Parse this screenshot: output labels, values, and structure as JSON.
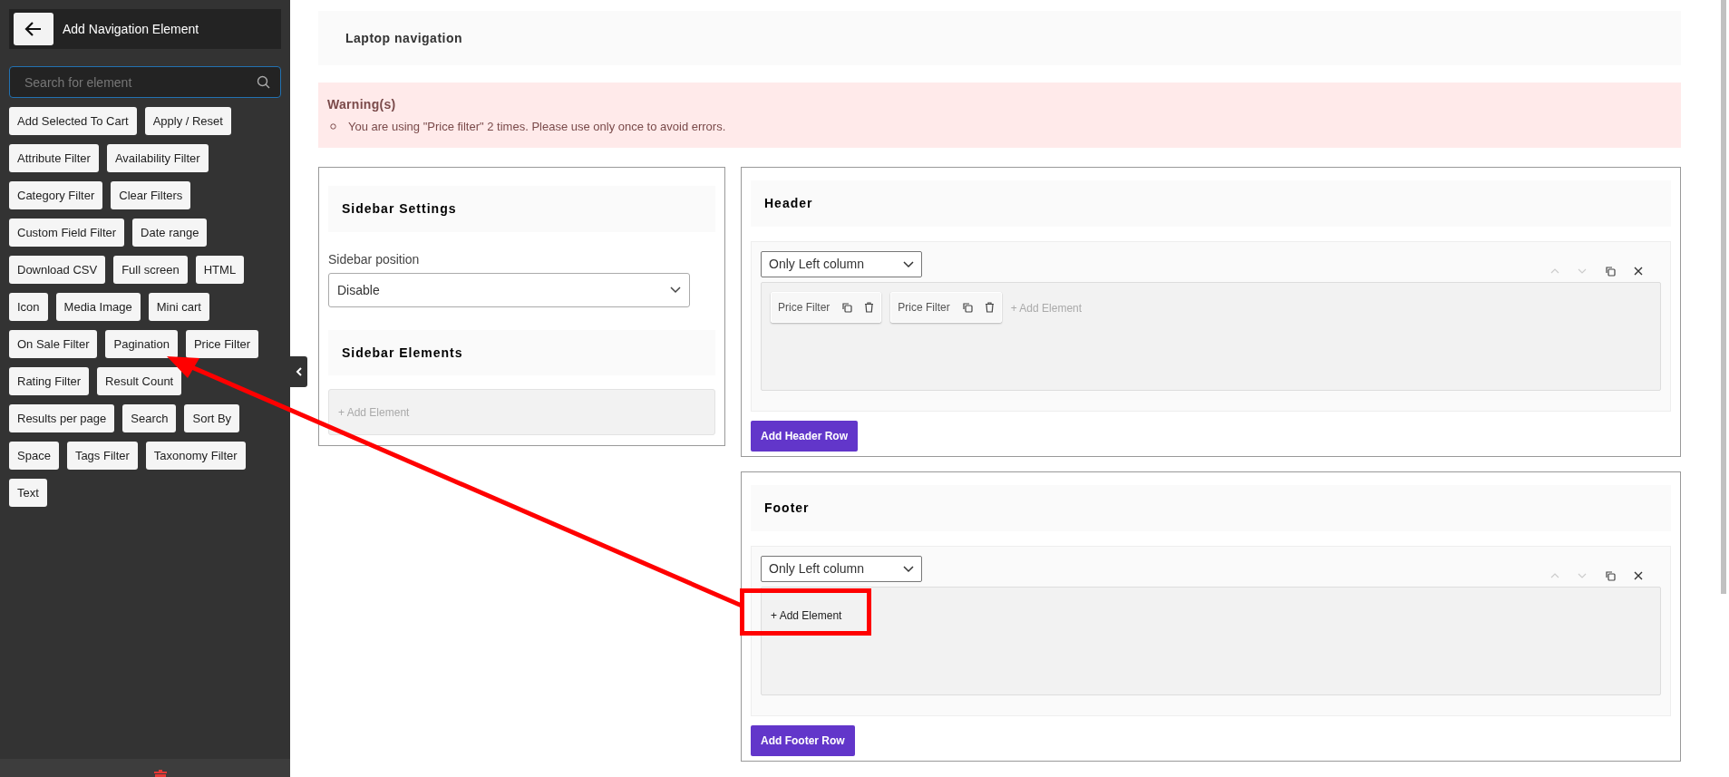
{
  "panel": {
    "title": "Add Navigation Element",
    "search": {
      "placeholder": "Search for element"
    },
    "elements": [
      "Add Selected To Cart",
      "Apply / Reset",
      "Attribute Filter",
      "Availability Filter",
      "Category Filter",
      "Clear Filters",
      "Custom Field Filter",
      "Date range",
      "Download CSV",
      "Full screen",
      "HTML",
      "Icon",
      "Media Image",
      "Mini cart",
      "On Sale Filter",
      "Pagination",
      "Price Filter",
      "Rating Filter",
      "Result Count",
      "Results per page",
      "Search",
      "Sort By",
      "Space",
      "Tags Filter",
      "Taxonomy Filter",
      "Text"
    ]
  },
  "page_title": "Laptop navigation",
  "warning": {
    "title": "Warning(s)",
    "messages": [
      "You are using \"Price filter\" 2 times. Please use only once to avoid errors."
    ]
  },
  "sidebar_settings": {
    "title": "Sidebar Settings",
    "position_label": "Sidebar position",
    "position_value": "Disable",
    "elements_title": "Sidebar Elements",
    "add_element": "+ Add Element"
  },
  "sections": [
    {
      "title": "Header",
      "layout": "Only Left column",
      "elements": [
        "Price Filter",
        "Price Filter"
      ],
      "add_element": "+ Add Element",
      "highlighted": false,
      "add_row": "Add Header Row"
    },
    {
      "title": "Footer",
      "layout": "Only Left column",
      "add_element": "+ Add Element",
      "highlighted": true,
      "add_row": "Add Footer Row"
    }
  ]
}
